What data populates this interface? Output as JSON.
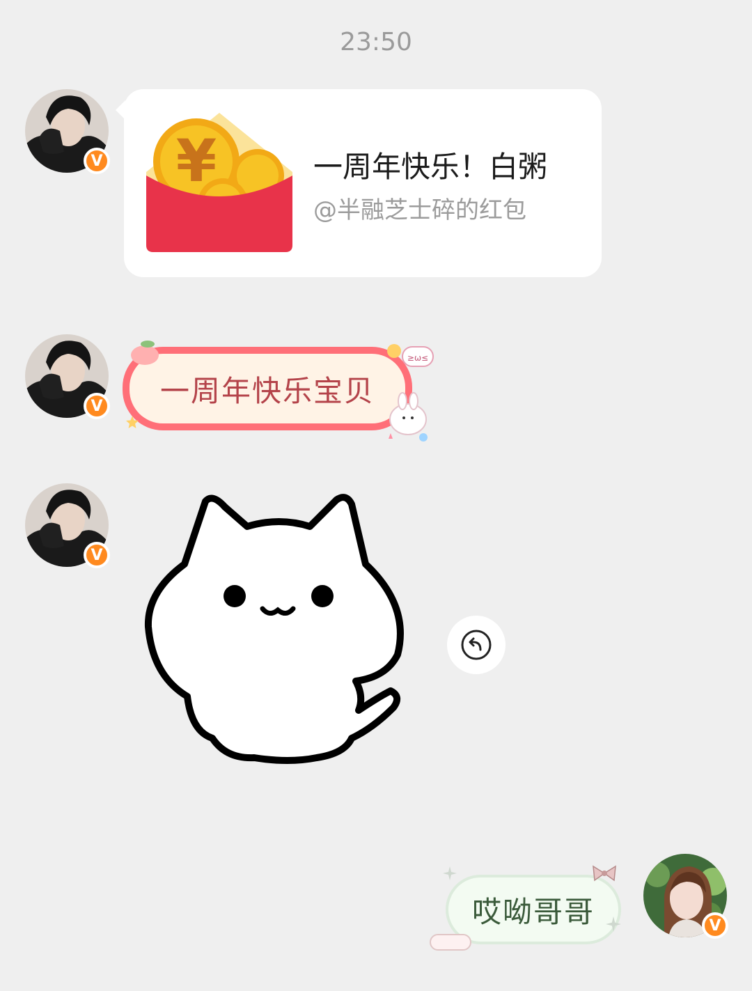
{
  "timestamp": "23:50",
  "messages": {
    "red_packet": {
      "title": "一周年快乐！白粥",
      "subtitle": "@半融芝士碎的红包",
      "currency_symbol": "¥"
    },
    "text_1": "一周年快乐宝贝",
    "sticker": {
      "type": "white-cat-sticker"
    },
    "text_2": "哎呦哥哥"
  },
  "badge_label": "V",
  "colors": {
    "background": "#efefef",
    "badge": "#ff8a1f",
    "packet_red": "#e8334a",
    "packet_gold": "#f7c325",
    "bubble1_border": "#ff6f78",
    "bubble1_text": "#b4434a",
    "bubble2_text": "#3a5a3a"
  }
}
